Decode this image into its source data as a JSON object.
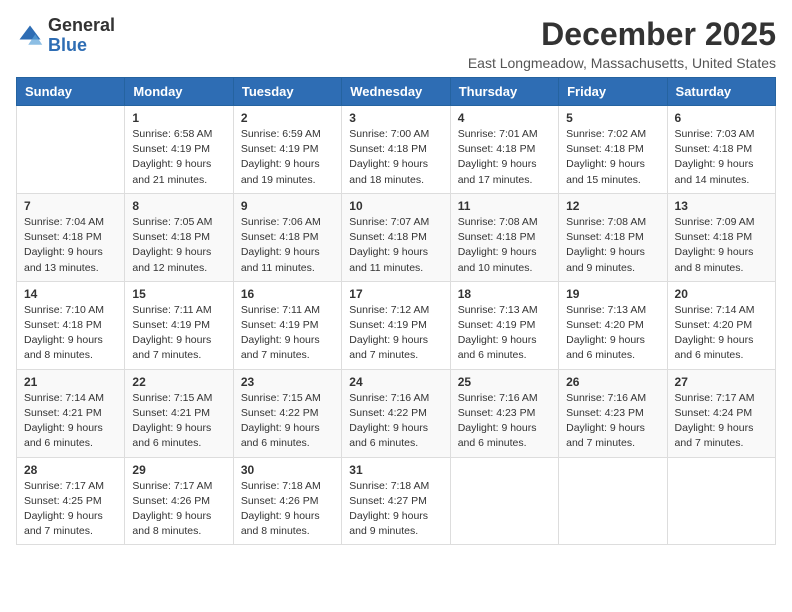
{
  "logo": {
    "general": "General",
    "blue": "Blue"
  },
  "header": {
    "month": "December 2025",
    "location": "East Longmeadow, Massachusetts, United States"
  },
  "weekdays": [
    "Sunday",
    "Monday",
    "Tuesday",
    "Wednesday",
    "Thursday",
    "Friday",
    "Saturday"
  ],
  "weeks": [
    [
      {
        "day": "",
        "info": ""
      },
      {
        "day": "1",
        "info": "Sunrise: 6:58 AM\nSunset: 4:19 PM\nDaylight: 9 hours\nand 21 minutes."
      },
      {
        "day": "2",
        "info": "Sunrise: 6:59 AM\nSunset: 4:19 PM\nDaylight: 9 hours\nand 19 minutes."
      },
      {
        "day": "3",
        "info": "Sunrise: 7:00 AM\nSunset: 4:18 PM\nDaylight: 9 hours\nand 18 minutes."
      },
      {
        "day": "4",
        "info": "Sunrise: 7:01 AM\nSunset: 4:18 PM\nDaylight: 9 hours\nand 17 minutes."
      },
      {
        "day": "5",
        "info": "Sunrise: 7:02 AM\nSunset: 4:18 PM\nDaylight: 9 hours\nand 15 minutes."
      },
      {
        "day": "6",
        "info": "Sunrise: 7:03 AM\nSunset: 4:18 PM\nDaylight: 9 hours\nand 14 minutes."
      }
    ],
    [
      {
        "day": "7",
        "info": "Sunrise: 7:04 AM\nSunset: 4:18 PM\nDaylight: 9 hours\nand 13 minutes."
      },
      {
        "day": "8",
        "info": "Sunrise: 7:05 AM\nSunset: 4:18 PM\nDaylight: 9 hours\nand 12 minutes."
      },
      {
        "day": "9",
        "info": "Sunrise: 7:06 AM\nSunset: 4:18 PM\nDaylight: 9 hours\nand 11 minutes."
      },
      {
        "day": "10",
        "info": "Sunrise: 7:07 AM\nSunset: 4:18 PM\nDaylight: 9 hours\nand 11 minutes."
      },
      {
        "day": "11",
        "info": "Sunrise: 7:08 AM\nSunset: 4:18 PM\nDaylight: 9 hours\nand 10 minutes."
      },
      {
        "day": "12",
        "info": "Sunrise: 7:08 AM\nSunset: 4:18 PM\nDaylight: 9 hours\nand 9 minutes."
      },
      {
        "day": "13",
        "info": "Sunrise: 7:09 AM\nSunset: 4:18 PM\nDaylight: 9 hours\nand 8 minutes."
      }
    ],
    [
      {
        "day": "14",
        "info": "Sunrise: 7:10 AM\nSunset: 4:18 PM\nDaylight: 9 hours\nand 8 minutes."
      },
      {
        "day": "15",
        "info": "Sunrise: 7:11 AM\nSunset: 4:19 PM\nDaylight: 9 hours\nand 7 minutes."
      },
      {
        "day": "16",
        "info": "Sunrise: 7:11 AM\nSunset: 4:19 PM\nDaylight: 9 hours\nand 7 minutes."
      },
      {
        "day": "17",
        "info": "Sunrise: 7:12 AM\nSunset: 4:19 PM\nDaylight: 9 hours\nand 7 minutes."
      },
      {
        "day": "18",
        "info": "Sunrise: 7:13 AM\nSunset: 4:19 PM\nDaylight: 9 hours\nand 6 minutes."
      },
      {
        "day": "19",
        "info": "Sunrise: 7:13 AM\nSunset: 4:20 PM\nDaylight: 9 hours\nand 6 minutes."
      },
      {
        "day": "20",
        "info": "Sunrise: 7:14 AM\nSunset: 4:20 PM\nDaylight: 9 hours\nand 6 minutes."
      }
    ],
    [
      {
        "day": "21",
        "info": "Sunrise: 7:14 AM\nSunset: 4:21 PM\nDaylight: 9 hours\nand 6 minutes."
      },
      {
        "day": "22",
        "info": "Sunrise: 7:15 AM\nSunset: 4:21 PM\nDaylight: 9 hours\nand 6 minutes."
      },
      {
        "day": "23",
        "info": "Sunrise: 7:15 AM\nSunset: 4:22 PM\nDaylight: 9 hours\nand 6 minutes."
      },
      {
        "day": "24",
        "info": "Sunrise: 7:16 AM\nSunset: 4:22 PM\nDaylight: 9 hours\nand 6 minutes."
      },
      {
        "day": "25",
        "info": "Sunrise: 7:16 AM\nSunset: 4:23 PM\nDaylight: 9 hours\nand 6 minutes."
      },
      {
        "day": "26",
        "info": "Sunrise: 7:16 AM\nSunset: 4:23 PM\nDaylight: 9 hours\nand 7 minutes."
      },
      {
        "day": "27",
        "info": "Sunrise: 7:17 AM\nSunset: 4:24 PM\nDaylight: 9 hours\nand 7 minutes."
      }
    ],
    [
      {
        "day": "28",
        "info": "Sunrise: 7:17 AM\nSunset: 4:25 PM\nDaylight: 9 hours\nand 7 minutes."
      },
      {
        "day": "29",
        "info": "Sunrise: 7:17 AM\nSunset: 4:26 PM\nDaylight: 9 hours\nand 8 minutes."
      },
      {
        "day": "30",
        "info": "Sunrise: 7:18 AM\nSunset: 4:26 PM\nDaylight: 9 hours\nand 8 minutes."
      },
      {
        "day": "31",
        "info": "Sunrise: 7:18 AM\nSunset: 4:27 PM\nDaylight: 9 hours\nand 9 minutes."
      },
      {
        "day": "",
        "info": ""
      },
      {
        "day": "",
        "info": ""
      },
      {
        "day": "",
        "info": ""
      }
    ]
  ]
}
